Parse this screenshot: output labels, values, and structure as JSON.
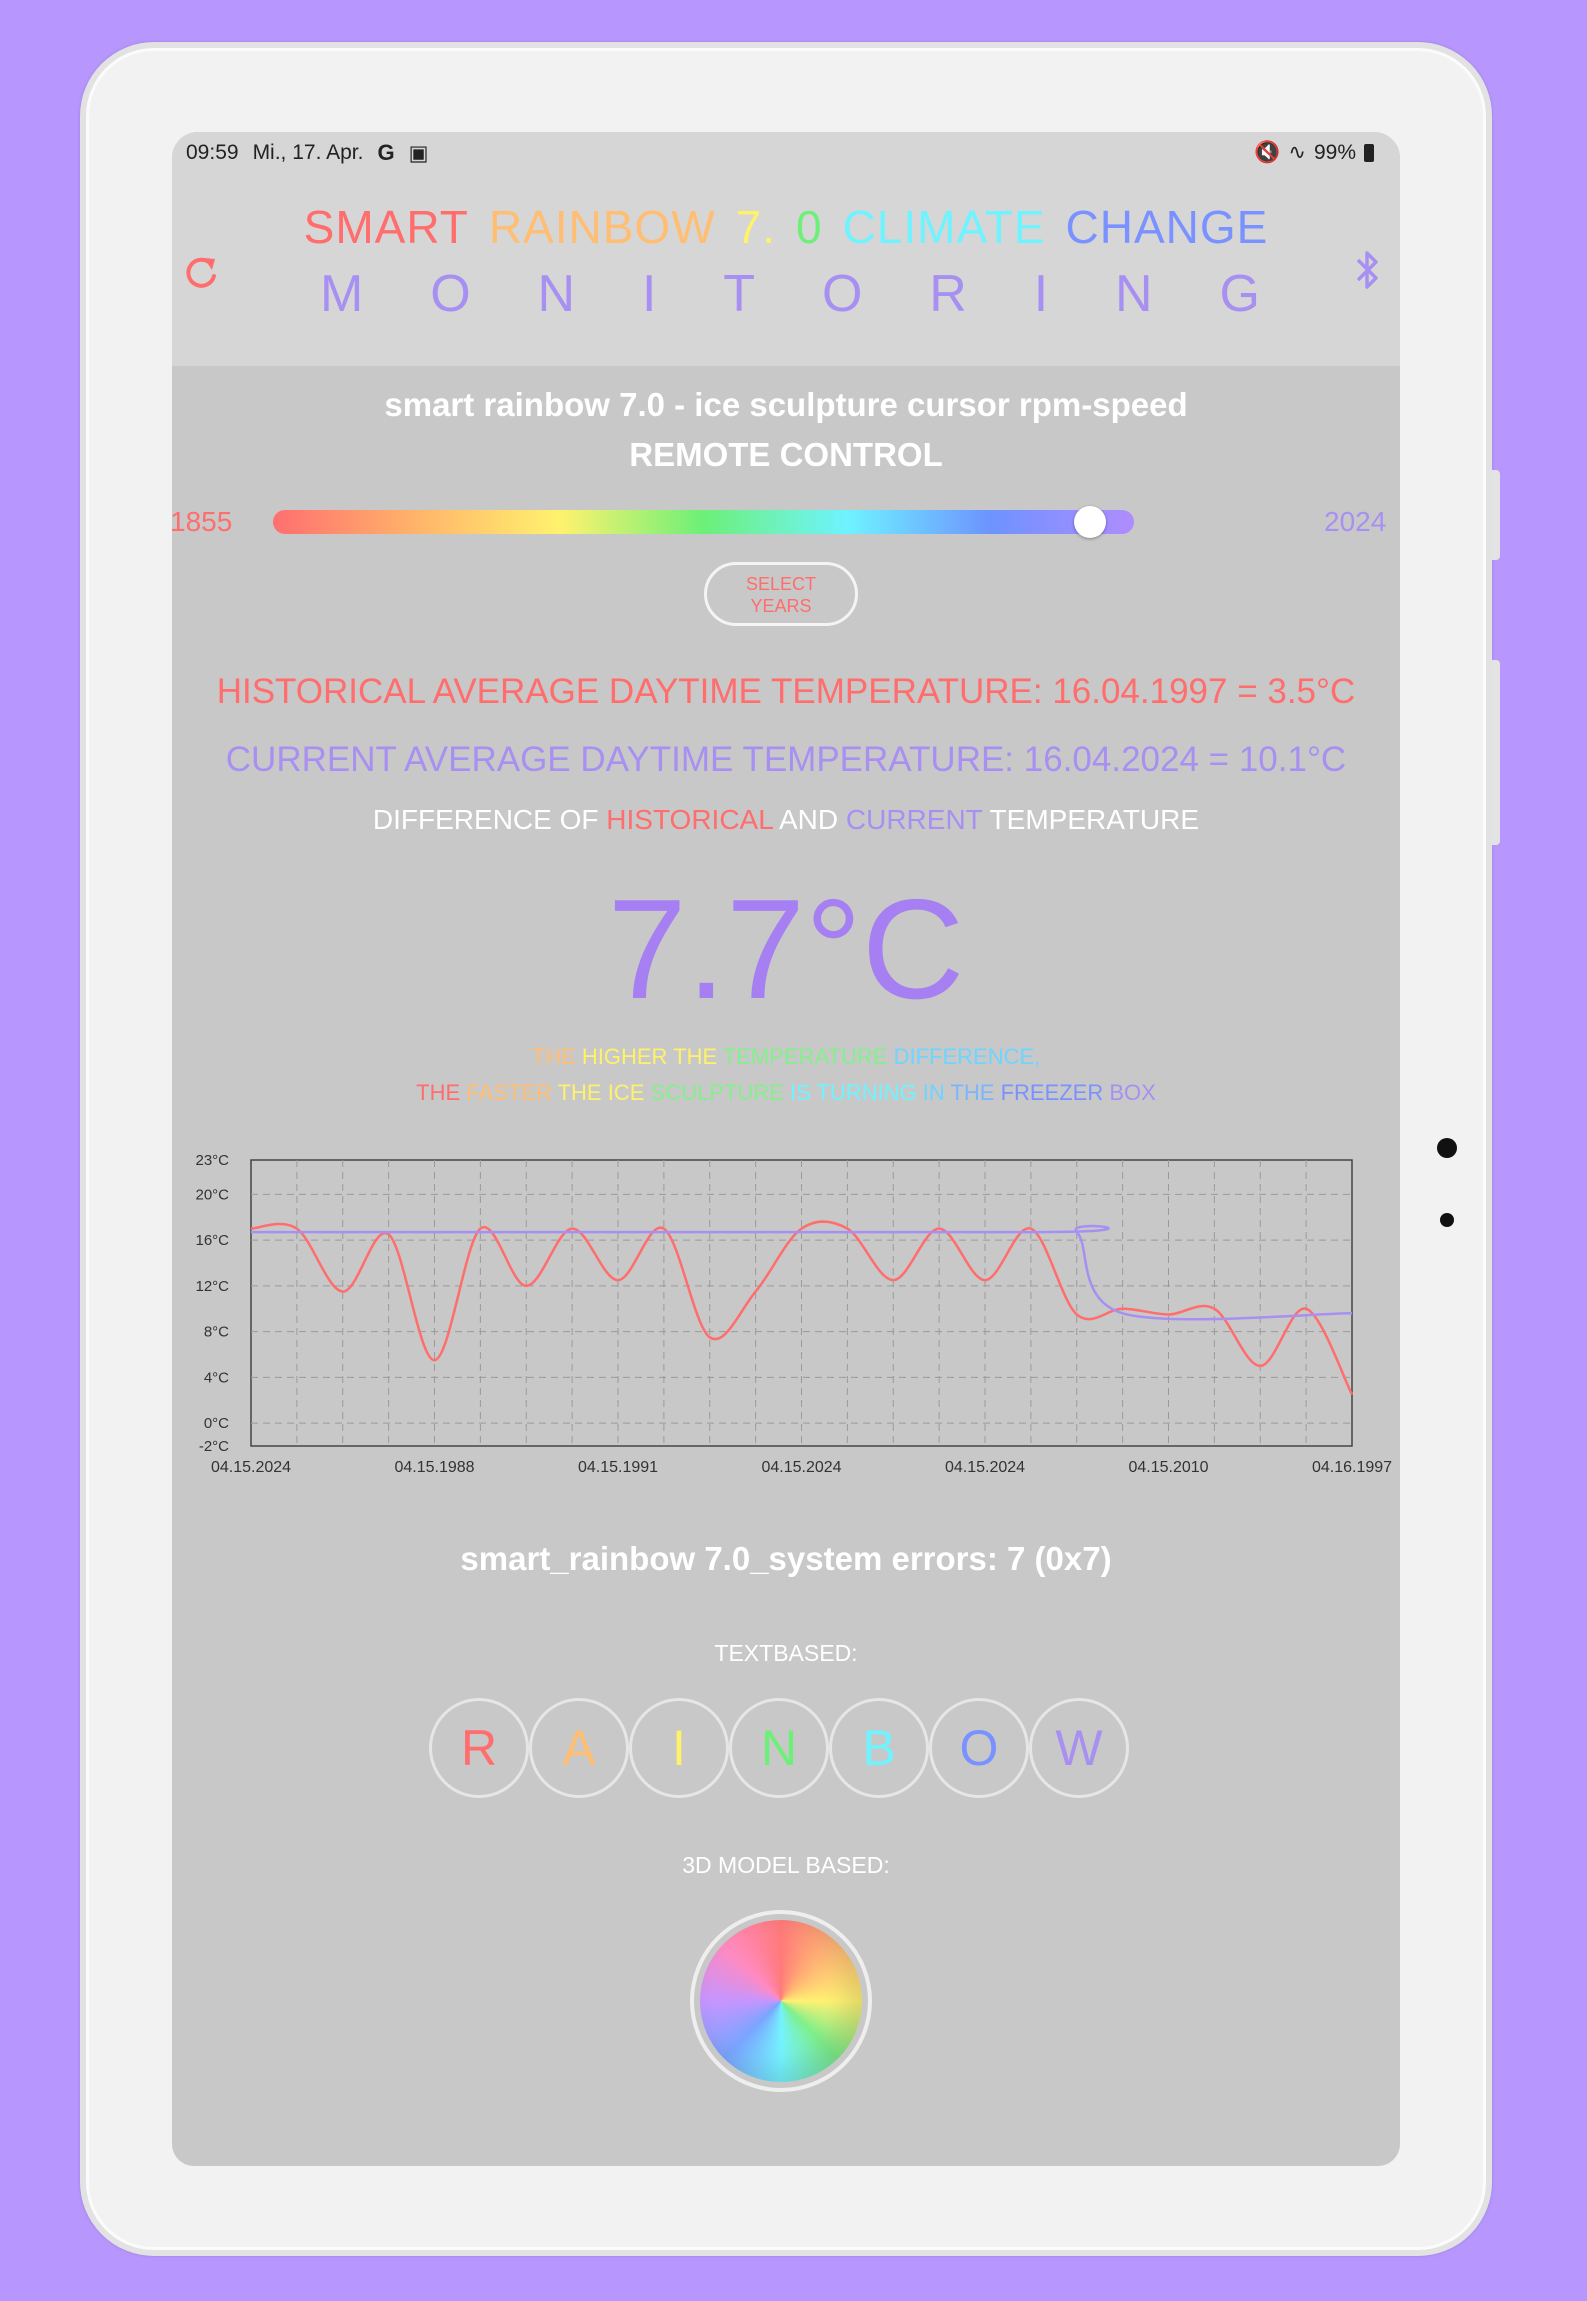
{
  "status_bar": {
    "time": "09:59",
    "date": "Mi., 17. Apr.",
    "battery": "99%"
  },
  "header": {
    "title_words": [
      {
        "text": "SMART",
        "color": "#ff6d6d"
      },
      {
        "text": "RAINBOW",
        "color": "#ffbe72"
      },
      {
        "text": "7.",
        "color": "#fff26a"
      },
      {
        "text": "0",
        "color": "#6cf078"
      },
      {
        "text": "CLIMATE",
        "color": "#6ff3ff"
      },
      {
        "text": "CHANGE",
        "color": "#7a92ff"
      }
    ],
    "subtitle_letters": [
      "M",
      "O",
      "N",
      "I",
      "T",
      "O",
      "R",
      "I",
      "N",
      "G"
    ],
    "refresh_icon": "refresh-icon",
    "bluetooth_icon": "bluetooth-icon"
  },
  "control": {
    "title": "smart rainbow 7.0 - ice sculpture cursor rpm-speed",
    "subtitle": "REMOTE CONTROL",
    "slider": {
      "min_label": "1855",
      "max_label": "2024",
      "value_fraction": 0.93
    },
    "select_button": "SELECT\nYEARS"
  },
  "temperatures": {
    "historical": "HISTORICAL AVERAGE DAYTIME TEMPERATURE: 16.04.1997 = 3.5°C",
    "current": "CURRENT AVERAGE DAYTIME TEMPERATURE: 16.04.2024 = 10.1°C",
    "difference_label": {
      "part1": "DIFFERENCE OF ",
      "historical": "HISTORICAL",
      "and": " AND ",
      "current": "CURRENT",
      "part2": " TEMPERATURE"
    },
    "difference_value": "7.7°C"
  },
  "notes": {
    "line1": [
      {
        "text": "THE ",
        "color": "#ffbe72"
      },
      {
        "text": "HIGHER ",
        "color": "#fff26a"
      },
      {
        "text": "THE ",
        "color": "#fff26a"
      },
      {
        "text": "TEMPERATURE ",
        "color": "#84f08b"
      },
      {
        "text": "DIFFERENCE,",
        "color": "#6fd4ff"
      }
    ],
    "line2": [
      {
        "text": "THE ",
        "color": "#ff6d6d"
      },
      {
        "text": "FASTER ",
        "color": "#ffbe72"
      },
      {
        "text": "THE ",
        "color": "#fff26a"
      },
      {
        "text": "ICE ",
        "color": "#fff26a"
      },
      {
        "text": "SCULPTURE ",
        "color": "#84f08b"
      },
      {
        "text": "IS ",
        "color": "#6ff3ff"
      },
      {
        "text": "TURNING ",
        "color": "#6ff3ff"
      },
      {
        "text": "IN ",
        "color": "#6fd4ff"
      },
      {
        "text": "THE ",
        "color": "#7ab5ff"
      },
      {
        "text": "FREEZER ",
        "color": "#7a92ff"
      },
      {
        "text": "BOX",
        "color": "#a890f2"
      }
    ]
  },
  "chart_data": {
    "type": "line",
    "x_tick_labels": [
      "04.15.2024",
      "04.15.1988",
      "04.15.1991",
      "04.15.2024",
      "04.15.2024",
      "04.15.2010",
      "04.16.1997"
    ],
    "y_tick_labels": [
      "23°C",
      "20°C",
      "16°C",
      "12°C",
      "8°C",
      "4°C",
      "0°C",
      "-2°C"
    ],
    "ylim": [
      -2,
      23
    ],
    "grid": true,
    "series": [
      {
        "color": "#ff6d6d",
        "x": [
          0,
          0.25,
          0.5,
          0.75,
          1,
          1.25,
          1.5,
          1.75,
          2,
          2.25,
          2.5,
          2.75,
          3,
          3.25,
          3.5,
          3.75,
          4,
          4.25,
          4.5,
          4.75,
          5,
          5.25,
          5.5,
          5.75,
          6
        ],
        "values": [
          17,
          17,
          11.5,
          16.5,
          5.5,
          17,
          12,
          17,
          12.5,
          17,
          7.5,
          11.5,
          17,
          17,
          12.5,
          17,
          12.5,
          17,
          9.5,
          10,
          9.5,
          10,
          5,
          10,
          2.5
        ]
      },
      {
        "color": "#a890f2",
        "x": [
          0,
          4.3,
          4.5,
          4.75,
          6
        ],
        "values": [
          16.7,
          16.7,
          16.7,
          9.6,
          9.6
        ]
      }
    ]
  },
  "errors": "smart_rainbow 7.0_system errors: 7 (0x7)",
  "textbased": {
    "label": "TEXTBASED:",
    "letters": [
      {
        "text": "R",
        "color": "#ff6d6d"
      },
      {
        "text": "A",
        "color": "#ffbe72"
      },
      {
        "text": "I",
        "color": "#fff26a"
      },
      {
        "text": "N",
        "color": "#6cf078"
      },
      {
        "text": "B",
        "color": "#6ff3ff"
      },
      {
        "text": "O",
        "color": "#7a92ff"
      },
      {
        "text": "W",
        "color": "#a890f2"
      }
    ]
  },
  "model": {
    "label": "3D MODEL BASED:"
  }
}
